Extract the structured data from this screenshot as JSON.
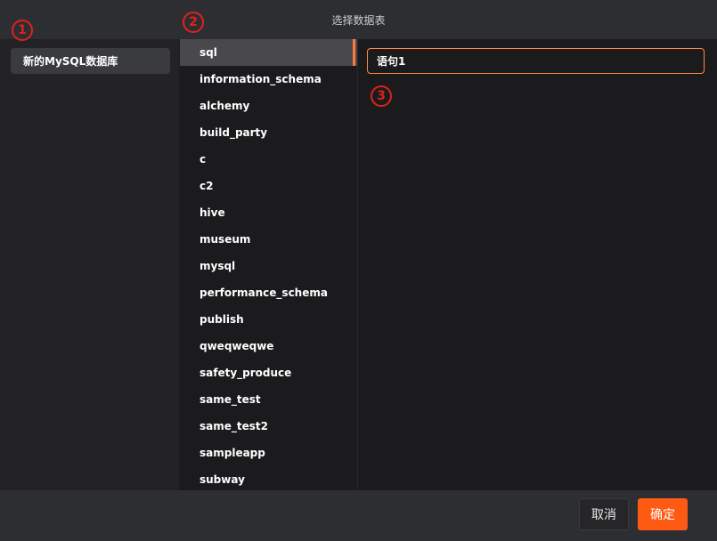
{
  "dialog": {
    "title": "选择数据表"
  },
  "databases": {
    "items": [
      {
        "label": "新的MySQL数据库"
      }
    ]
  },
  "schemas": {
    "selected_index": 0,
    "items": [
      "sql",
      "information_schema",
      "alchemy",
      "build_party",
      "c",
      "c2",
      "hive",
      "museum",
      "mysql",
      "performance_schema",
      "publish",
      "qweqweqwe",
      "safety_produce",
      "same_test",
      "same_test2",
      "sampleapp",
      "subway"
    ]
  },
  "tables": {
    "items": [
      {
        "label": "语句1"
      }
    ]
  },
  "footer": {
    "cancel_label": "取消",
    "confirm_label": "确定"
  },
  "annotations": {
    "marker_1": "1",
    "marker_2": "2",
    "marker_3": "3"
  },
  "colors": {
    "accent": "#ff5a14",
    "selected_border": "#ff8a45",
    "annotation_red": "#e0211c"
  }
}
